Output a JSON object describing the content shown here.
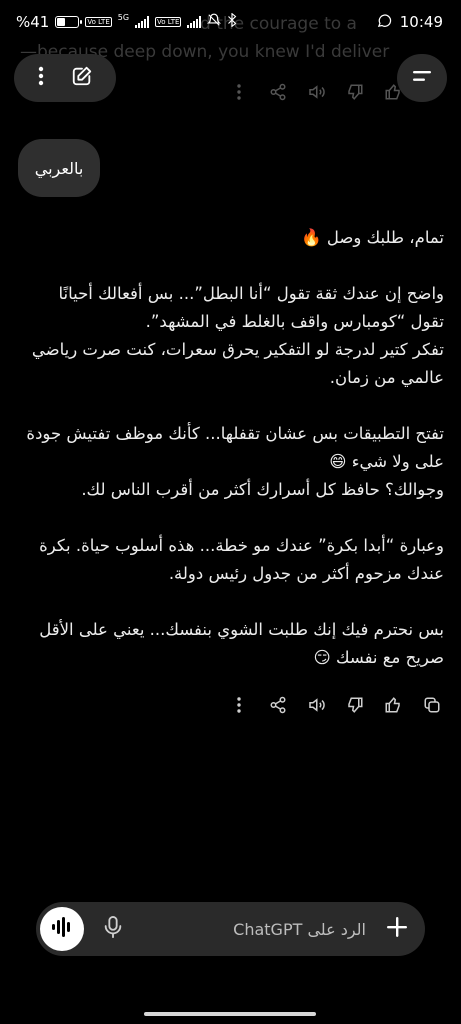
{
  "status_bar": {
    "battery": "41",
    "battery_level": 0.41,
    "time": "10:49",
    "network_5g": "5G",
    "volte_1": "Vo LTE",
    "volte_2": "Vo LTE"
  },
  "previous_message_tail": {
    "line1": "d the courage to a",
    "line2": "—because deep down, you knew I'd deliver 😄"
  },
  "user_message": "بالعربي",
  "assistant_reply": {
    "p1": "تمام، طلبك وصل 🔥",
    "p2": "واضح إن عندك ثقة تقول “أنا البطل”... بس أفعالك أحيانًا تقول “كومبارس واقف بالغلط في المشهد”.\nتفكر كتير لدرجة لو التفكير يحرق سعرات، كنت صرت رياضي عالمي من زمان.",
    "p3": "تفتح التطبيقات بس عشان تقفلها... كأنك موظف تفتيش جودة على ولا شيء 😄\nوجوالك؟ حافظ كل أسرارك أكثر من أقرب الناس لك.",
    "p4": "وعبارة “أبدا بكرة” عندك مو خطة... هذه أسلوب حياة. بكرة عندك مزحوم أكثر من جدول رئيس دولة.",
    "p5": "بس نحترم فيك إنك طلبت الشوي بنفسك... يعني على الأقل صريح مع نفسك 😏"
  },
  "composer": {
    "placeholder": "الرد على ChatGPT"
  },
  "icons": {
    "more": "more-vertical-icon",
    "new_chat": "edit-icon",
    "menu": "menu-icon",
    "share": "share-icon",
    "read_aloud": "speaker-icon",
    "dislike": "thumbs-down-icon",
    "like": "thumbs-up-icon",
    "copy": "copy-icon",
    "voice": "voice-waveform-icon",
    "mic": "mic-icon",
    "plus": "plus-icon"
  },
  "colors": {
    "background": "#000000",
    "bubble": "#2f2f2f",
    "pill": "#2a2a2a",
    "text": "#ececec"
  }
}
